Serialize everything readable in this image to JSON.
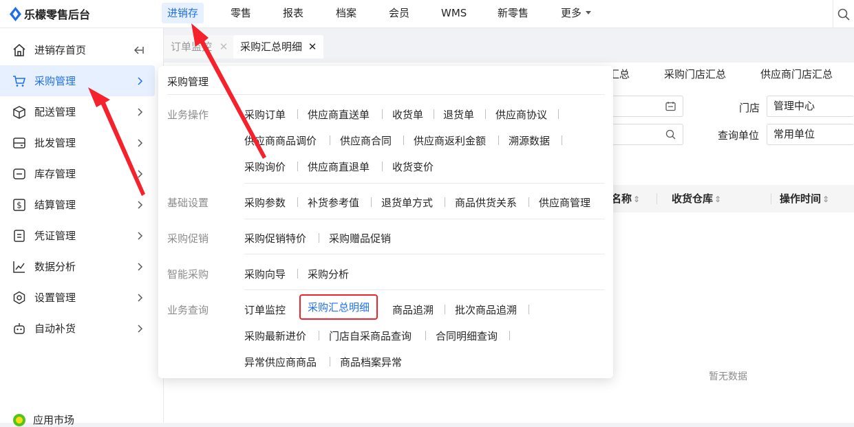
{
  "app": {
    "name": "乐檬零售后台"
  },
  "topnav": [
    {
      "label": "进销存",
      "active": true
    },
    {
      "label": "零售"
    },
    {
      "label": "报表"
    },
    {
      "label": "档案"
    },
    {
      "label": "会员"
    },
    {
      "label": "WMS"
    },
    {
      "label": "新零售"
    },
    {
      "label": "更多"
    }
  ],
  "sidebar": {
    "items": [
      {
        "label": "进销存首页",
        "icon": "home-icon"
      },
      {
        "label": "采购管理",
        "icon": "cart-icon",
        "active": true
      },
      {
        "label": "配送管理",
        "icon": "box-icon"
      },
      {
        "label": "批发管理",
        "icon": "wallet-icon"
      },
      {
        "label": "库存管理",
        "icon": "inventory-icon"
      },
      {
        "label": "结算管理",
        "icon": "dollar-icon"
      },
      {
        "label": "凭证管理",
        "icon": "document-icon"
      },
      {
        "label": "数据分析",
        "icon": "chart-icon"
      },
      {
        "label": "设置管理",
        "icon": "gear-icon"
      },
      {
        "label": "自动补货",
        "icon": "robot-icon"
      }
    ],
    "bottom_label": "应用市场"
  },
  "tabs": [
    {
      "label": "订单监控"
    },
    {
      "label": "采购汇总明细",
      "active": true
    }
  ],
  "content": {
    "summary_tabs": [
      "汇总",
      "采购门店汇总",
      "供应商门店汇总"
    ],
    "filters": {
      "store_label": "门店",
      "store_value": "管理中心",
      "unit_label": "查询单位",
      "unit_value": "常用单位"
    },
    "columns": [
      "名称",
      "收货仓库",
      "操作时间"
    ],
    "empty_text": "暂无数据"
  },
  "dropdown": {
    "title": "采购管理",
    "groups": [
      {
        "name": "业务操作",
        "rows": [
          [
            "采购订单",
            "供应商直送单",
            "收货单",
            "退货单",
            "供应商协议"
          ],
          [
            "供应商商品调价",
            "供应商合同",
            "供应商返利金额",
            "溯源数据"
          ],
          [
            "采购询价",
            "供应商直退单",
            "收货变价"
          ]
        ]
      },
      {
        "name": "基础设置",
        "rows": [
          [
            "采购参数",
            "补货参考值",
            "退货单方式",
            "商品供货关系",
            "供应商管理"
          ]
        ]
      },
      {
        "name": "采购促销",
        "rows": [
          [
            "采购促销特价",
            "采购赠品促销"
          ]
        ]
      },
      {
        "name": "智能采购",
        "rows": [
          [
            "采购向导",
            "采购分析"
          ]
        ]
      },
      {
        "name": "业务查询",
        "rows": [
          [
            "订单监控",
            "采购汇总明细",
            "商品追溯",
            "批次商品追溯"
          ],
          [
            "采购最新进价",
            "门店自采商品查询",
            "合同明细查询"
          ],
          [
            "异常供应商商品",
            "商品档案异常"
          ]
        ]
      }
    ]
  },
  "colors": {
    "accent": "#1f6feb",
    "arrow": "#f5222d",
    "active_bg": "#e6f0ff"
  }
}
